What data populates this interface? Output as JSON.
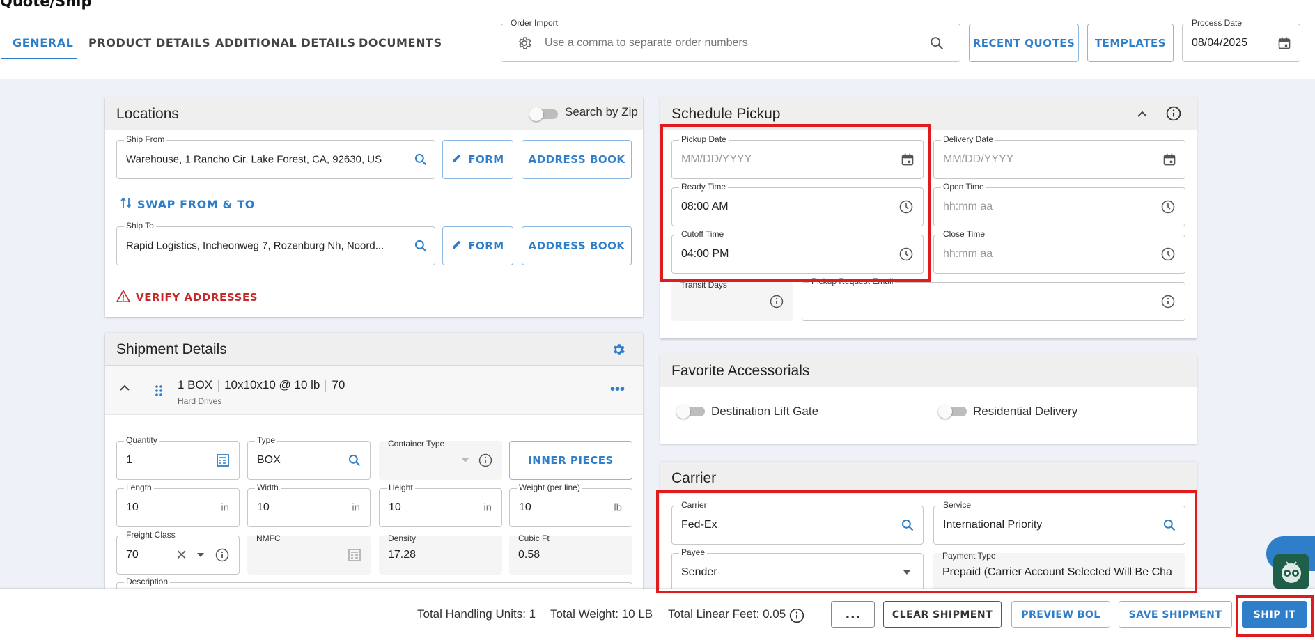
{
  "page": {
    "title": "Quote/Ship"
  },
  "tabs": [
    {
      "label": "GENERAL",
      "active": true
    },
    {
      "label": "PRODUCT DETAILS"
    },
    {
      "label": "ADDITIONAL DETAILS"
    },
    {
      "label": "DOCUMENTS"
    }
  ],
  "order_import": {
    "label": "Order Import",
    "placeholder": "Use a comma to separate order numbers"
  },
  "header_buttons": {
    "recent_quotes": "RECENT QUOTES",
    "templates": "TEMPLATES"
  },
  "process_date": {
    "label": "Process Date",
    "value": "08/04/2025"
  },
  "locations": {
    "title": "Locations",
    "search_by_zip": "Search by Zip",
    "ship_from": {
      "label": "Ship From",
      "value": "Warehouse, 1 Rancho Cir, Lake Forest, CA, 92630, US"
    },
    "ship_to": {
      "label": "Ship To",
      "value": "Rapid Logistics, Incheonweg 7, Rozenburg Nh, Noord..."
    },
    "form_label": "FORM",
    "address_book_label": "ADDRESS BOOK",
    "swap_label": "SWAP FROM & TO",
    "verify_label": "VERIFY ADDRESSES"
  },
  "shipment_details": {
    "title": "Shipment Details",
    "item": {
      "qty_type": "1 BOX",
      "dims": "10x10x10 @ 10 lb",
      "class": "70",
      "description": "Hard Drives"
    },
    "quantity": {
      "label": "Quantity",
      "value": "1"
    },
    "type": {
      "label": "Type",
      "value": "BOX"
    },
    "container_type": {
      "label": "Container Type",
      "value": ""
    },
    "inner_pieces": "INNER PIECES",
    "length": {
      "label": "Length",
      "value": "10",
      "unit": "in"
    },
    "width": {
      "label": "Width",
      "value": "10",
      "unit": "in"
    },
    "height": {
      "label": "Height",
      "value": "10",
      "unit": "in"
    },
    "weight": {
      "label": "Weight (per line)",
      "value": "10",
      "unit": "lb"
    },
    "freight_class": {
      "label": "Freight Class",
      "value": "70"
    },
    "nmfc": {
      "label": "NMFC",
      "value": ""
    },
    "density": {
      "label": "Density",
      "value": "17.28"
    },
    "cubic_ft": {
      "label": "Cubic Ft",
      "value": "0.58"
    },
    "description_label": "Description"
  },
  "schedule_pickup": {
    "title": "Schedule Pickup",
    "pickup_date": {
      "label": "Pickup Date",
      "placeholder": "MM/DD/YYYY"
    },
    "delivery_date": {
      "label": "Delivery Date",
      "placeholder": "MM/DD/YYYY"
    },
    "ready_time": {
      "label": "Ready Time",
      "value": "08:00 AM"
    },
    "open_time": {
      "label": "Open Time",
      "placeholder": "hh:mm aa"
    },
    "cutoff_time": {
      "label": "Cutoff Time",
      "value": "04:00 PM"
    },
    "close_time": {
      "label": "Close Time",
      "placeholder": "hh:mm aa"
    },
    "transit_days": {
      "label": "Transit Days",
      "value": ""
    },
    "pickup_request_email": {
      "label": "Pickup Request Email",
      "value": ""
    }
  },
  "favorite_accessorials": {
    "title": "Favorite Accessorials",
    "items": [
      "Destination Lift Gate",
      "Residential Delivery"
    ]
  },
  "carrier": {
    "title": "Carrier",
    "carrier": {
      "label": "Carrier",
      "value": "Fed-Ex"
    },
    "service": {
      "label": "Service",
      "value": "International Priority"
    },
    "payee": {
      "label": "Payee",
      "value": "Sender"
    },
    "payment_type": {
      "label": "Payment Type",
      "value": "Prepaid (Carrier Account Selected Will Be Cha"
    }
  },
  "footer": {
    "total_handling_units": "Total Handling Units: 1",
    "total_weight": "Total Weight: 10 LB",
    "total_linear_feet": "Total Linear Feet: 0.05",
    "more": "...",
    "clear_shipment": "CLEAR SHIPMENT",
    "preview_bol": "PREVIEW BOL",
    "save_shipment": "SAVE SHIPMENT",
    "ship_it": "SHIP IT"
  },
  "colors": {
    "accent": "#2f7ec9",
    "highlight": "#e01b1b",
    "warning": "#c62828"
  }
}
